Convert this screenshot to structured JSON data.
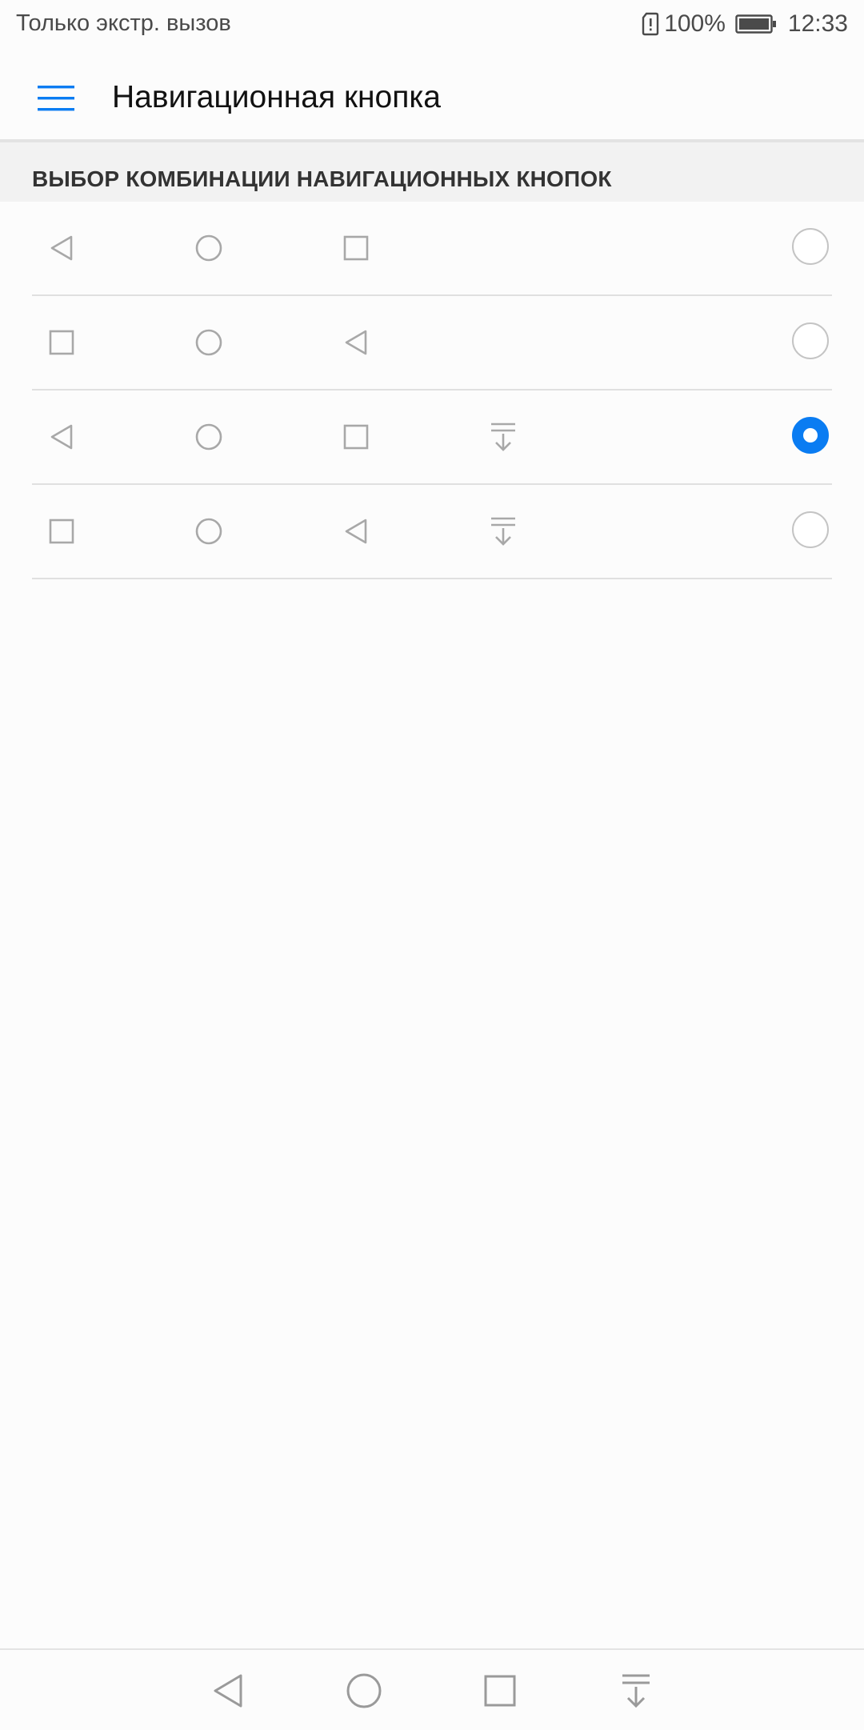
{
  "status_bar": {
    "left_text": "Только экстр. вызов",
    "battery_percent": "100%",
    "time": "12:33",
    "icons": [
      "sim-alert-icon",
      "battery-icon"
    ]
  },
  "app_bar": {
    "title": "Навигационная кнопка",
    "menu_icon": "hamburger-menu-icon",
    "accent_color": "#0a7cf2"
  },
  "section": {
    "title": "ВЫБОР КОМБИНАЦИИ НАВИГАЦИОННЫХ КНОПОК"
  },
  "options": [
    {
      "buttons": [
        "back",
        "home",
        "recents"
      ],
      "selected": false
    },
    {
      "buttons": [
        "recents",
        "home",
        "back"
      ],
      "selected": false
    },
    {
      "buttons": [
        "back",
        "home",
        "recents",
        "notifications"
      ],
      "selected": true
    },
    {
      "buttons": [
        "recents",
        "home",
        "back",
        "notifications"
      ],
      "selected": false
    }
  ],
  "system_nav": {
    "buttons": [
      "back",
      "home",
      "recents",
      "notifications"
    ]
  }
}
